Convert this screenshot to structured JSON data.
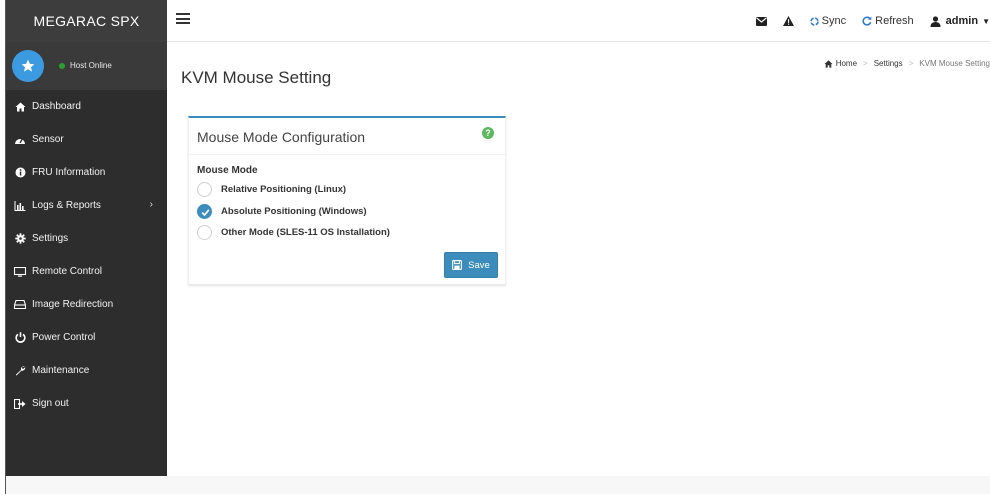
{
  "app": {
    "brand": "MEGARAC SPX"
  },
  "topbar": {
    "sync_label": "Sync",
    "refresh_label": "Refresh",
    "user_label": "admin"
  },
  "host": {
    "status_text": "Host Online",
    "status_color": "#2ca02c"
  },
  "sidebar": {
    "items": [
      {
        "label": "Dashboard",
        "icon": "home-icon"
      },
      {
        "label": "Sensor",
        "icon": "dashboard-icon"
      },
      {
        "label": "FRU Information",
        "icon": "info-icon"
      },
      {
        "label": "Logs & Reports",
        "icon": "bar-chart-icon",
        "has_submenu": true
      },
      {
        "label": "Settings",
        "icon": "gear-icon"
      },
      {
        "label": "Remote Control",
        "icon": "monitor-icon"
      },
      {
        "label": "Image Redirection",
        "icon": "drive-icon"
      },
      {
        "label": "Power Control",
        "icon": "power-icon"
      },
      {
        "label": "Maintenance",
        "icon": "wrench-icon"
      },
      {
        "label": "Sign out",
        "icon": "sign-out-icon"
      }
    ]
  },
  "page": {
    "title": "KVM Mouse Setting",
    "breadcrumb": [
      "Home",
      "Settings",
      "KVM Mouse Setting"
    ]
  },
  "card": {
    "title": "Mouse Mode Configuration",
    "field_label": "Mouse Mode",
    "options": [
      {
        "label": "Relative Positioning (Linux)",
        "checked": false
      },
      {
        "label": "Absolute Positioning (Windows)",
        "checked": true
      },
      {
        "label": "Other Mode (SLES-11 OS Installation)",
        "checked": false
      }
    ],
    "save_label": "Save",
    "help_glyph": "?"
  },
  "colors": {
    "accent": "#3c8dbc",
    "sidebar_bg": "#2d2d2d",
    "header_bg": "#3d3d3d",
    "avatar": "#3c9be0",
    "help": "#5cb85c"
  }
}
